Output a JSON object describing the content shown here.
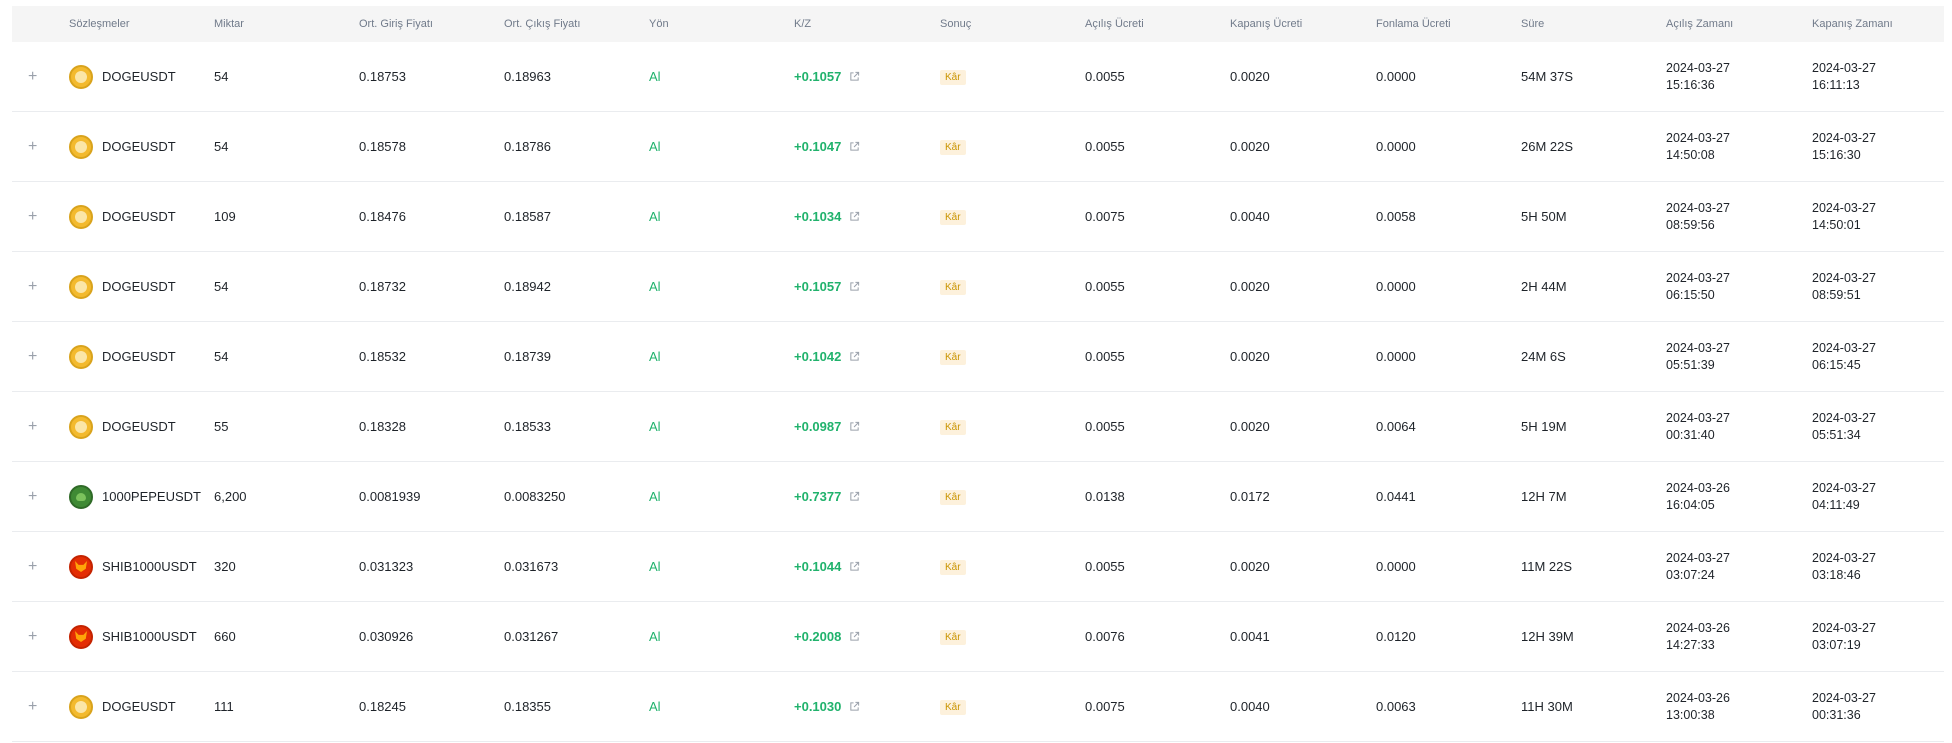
{
  "headers": {
    "contracts": "Sözleşmeler",
    "quantity": "Miktar",
    "avg_entry": "Ort. Giriş Fiyatı",
    "avg_exit": "Ort. Çıkış Fiyatı",
    "side": "Yön",
    "pnl": "K/Z",
    "result": "Sonuç",
    "open_fee": "Açılış Ücreti",
    "close_fee": "Kapanış Ücreti",
    "funding_fee": "Fonlama Ücreti",
    "duration": "Süre",
    "open_time": "Açılış Zamanı",
    "close_time": "Kapanış Zamanı"
  },
  "rows": [
    {
      "expand": "+",
      "icon": "doge",
      "symbol": "DOGEUSDT",
      "qty": "54",
      "entry": "0.18753",
      "exit": "0.18963",
      "side": "Al",
      "pnl": "+0.1057",
      "result": "Kâr",
      "open_fee": "0.0055",
      "close_fee": "0.0020",
      "funding_fee": "0.0000",
      "duration": "54M 37S",
      "open_date": "2024-03-27",
      "open_clock": "15:16:36",
      "close_date": "2024-03-27",
      "close_clock": "16:11:13"
    },
    {
      "expand": "+",
      "icon": "doge",
      "symbol": "DOGEUSDT",
      "qty": "54",
      "entry": "0.18578",
      "exit": "0.18786",
      "side": "Al",
      "pnl": "+0.1047",
      "result": "Kâr",
      "open_fee": "0.0055",
      "close_fee": "0.0020",
      "funding_fee": "0.0000",
      "duration": "26M 22S",
      "open_date": "2024-03-27",
      "open_clock": "14:50:08",
      "close_date": "2024-03-27",
      "close_clock": "15:16:30"
    },
    {
      "expand": "+",
      "icon": "doge",
      "symbol": "DOGEUSDT",
      "qty": "109",
      "entry": "0.18476",
      "exit": "0.18587",
      "side": "Al",
      "pnl": "+0.1034",
      "result": "Kâr",
      "open_fee": "0.0075",
      "close_fee": "0.0040",
      "funding_fee": "0.0058",
      "duration": "5H 50M",
      "open_date": "2024-03-27",
      "open_clock": "08:59:56",
      "close_date": "2024-03-27",
      "close_clock": "14:50:01"
    },
    {
      "expand": "+",
      "icon": "doge",
      "symbol": "DOGEUSDT",
      "qty": "54",
      "entry": "0.18732",
      "exit": "0.18942",
      "side": "Al",
      "pnl": "+0.1057",
      "result": "Kâr",
      "open_fee": "0.0055",
      "close_fee": "0.0020",
      "funding_fee": "0.0000",
      "duration": "2H 44M",
      "open_date": "2024-03-27",
      "open_clock": "06:15:50",
      "close_date": "2024-03-27",
      "close_clock": "08:59:51"
    },
    {
      "expand": "+",
      "icon": "doge",
      "symbol": "DOGEUSDT",
      "qty": "54",
      "entry": "0.18532",
      "exit": "0.18739",
      "side": "Al",
      "pnl": "+0.1042",
      "result": "Kâr",
      "open_fee": "0.0055",
      "close_fee": "0.0020",
      "funding_fee": "0.0000",
      "duration": "24M 6S",
      "open_date": "2024-03-27",
      "open_clock": "05:51:39",
      "close_date": "2024-03-27",
      "close_clock": "06:15:45"
    },
    {
      "expand": "+",
      "icon": "doge",
      "symbol": "DOGEUSDT",
      "qty": "55",
      "entry": "0.18328",
      "exit": "0.18533",
      "side": "Al",
      "pnl": "+0.0987",
      "result": "Kâr",
      "open_fee": "0.0055",
      "close_fee": "0.0020",
      "funding_fee": "0.0064",
      "duration": "5H 19M",
      "open_date": "2024-03-27",
      "open_clock": "00:31:40",
      "close_date": "2024-03-27",
      "close_clock": "05:51:34"
    },
    {
      "expand": "+",
      "icon": "pepe",
      "symbol": "1000PEPEUSDT",
      "qty": "6,200",
      "entry": "0.0081939",
      "exit": "0.0083250",
      "side": "Al",
      "pnl": "+0.7377",
      "result": "Kâr",
      "open_fee": "0.0138",
      "close_fee": "0.0172",
      "funding_fee": "0.0441",
      "duration": "12H 7M",
      "open_date": "2024-03-26",
      "open_clock": "16:04:05",
      "close_date": "2024-03-27",
      "close_clock": "04:11:49"
    },
    {
      "expand": "+",
      "icon": "shib",
      "symbol": "SHIB1000USDT",
      "qty": "320",
      "entry": "0.031323",
      "exit": "0.031673",
      "side": "Al",
      "pnl": "+0.1044",
      "result": "Kâr",
      "open_fee": "0.0055",
      "close_fee": "0.0020",
      "funding_fee": "0.0000",
      "duration": "11M 22S",
      "open_date": "2024-03-27",
      "open_clock": "03:07:24",
      "close_date": "2024-03-27",
      "close_clock": "03:18:46"
    },
    {
      "expand": "+",
      "icon": "shib",
      "symbol": "SHIB1000USDT",
      "qty": "660",
      "entry": "0.030926",
      "exit": "0.031267",
      "side": "Al",
      "pnl": "+0.2008",
      "result": "Kâr",
      "open_fee": "0.0076",
      "close_fee": "0.0041",
      "funding_fee": "0.0120",
      "duration": "12H 39M",
      "open_date": "2024-03-26",
      "open_clock": "14:27:33",
      "close_date": "2024-03-27",
      "close_clock": "03:07:19"
    },
    {
      "expand": "+",
      "icon": "doge",
      "symbol": "DOGEUSDT",
      "qty": "111",
      "entry": "0.18245",
      "exit": "0.18355",
      "side": "Al",
      "pnl": "+0.1030",
      "result": "Kâr",
      "open_fee": "0.0075",
      "close_fee": "0.0040",
      "funding_fee": "0.0063",
      "duration": "11H 30M",
      "open_date": "2024-03-26",
      "open_clock": "13:00:38",
      "close_date": "2024-03-27",
      "close_clock": "00:31:36"
    }
  ],
  "colors": {
    "profit_green": "#20b26c",
    "badge_bg": "#fdf1dc",
    "badge_text": "#c99400",
    "header_bg": "#f5f5f5"
  }
}
